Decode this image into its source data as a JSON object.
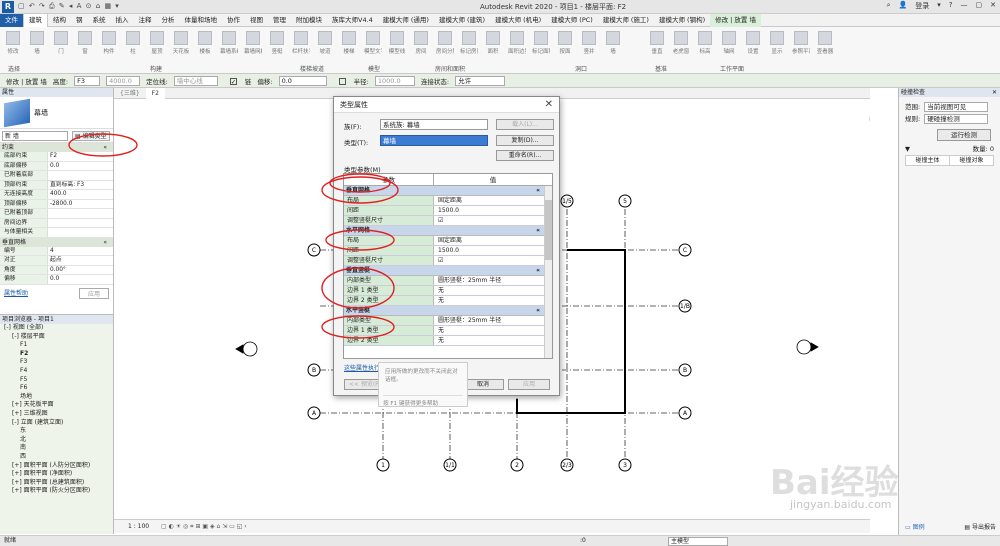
{
  "app": {
    "title": "Autodesk Revit 2020 - 项目1 - 楼层平面: F2",
    "user": "登录",
    "logo": "R"
  },
  "tabs": [
    "文件",
    "建筑",
    "结构",
    "钢",
    "系统",
    "插入",
    "注释",
    "分析",
    "体量和场地",
    "协作",
    "视图",
    "管理",
    "附加模块",
    "族库大师V4.4",
    "建模大师 (通用)",
    "建模大师 (建筑)",
    "建模大师 (机电)",
    "建模大师 (PC)",
    "建模大师 (施工)",
    "建模大师 (钢构)",
    "修改 | 放置 墙"
  ],
  "ribbon": {
    "buttons": [
      "修改",
      "墙",
      "门",
      "窗",
      "构件",
      "柱",
      "屋顶",
      "天花板",
      "楼板",
      "幕墙系统",
      "幕墙网格",
      "竖梃",
      "栏杆扶手",
      "坡道",
      "楼梯",
      "模型文字",
      "模型线",
      "房间",
      "房间分隔",
      "标记房间",
      "面积",
      "面积边界",
      "标记面积",
      "按面",
      "竖井",
      "墙",
      "垂直",
      "老虎窗",
      "标高",
      "轴网",
      "设置",
      "显示",
      "参照平面",
      "查看器"
    ],
    "panels": [
      "选择",
      "构建",
      "楼梯坡道",
      "模型",
      "房间和面积",
      "洞口",
      "基准",
      "工作平面"
    ]
  },
  "optbar": {
    "modify": "修改 | 放置 墙",
    "height_label": "高度:",
    "height_level": "F3",
    "height_value": "4000.0",
    "locline_label": "定位线:",
    "locline_value": "墙中心线",
    "chain_label": "链",
    "offset_label": "偏移:",
    "offset_value": "0.0",
    "radius_label": "半径:",
    "radius_value": "1000.0",
    "join_label": "连接状态:",
    "join_value": "允许"
  },
  "properties": {
    "header": "属性",
    "type_name": "幕墙",
    "new_label": "新 墙",
    "edit_type": "编辑类型",
    "constraints_head": "约束",
    "rows": [
      {
        "k": "底部约束",
        "v": "F2"
      },
      {
        "k": "底部偏移",
        "v": "0.0"
      },
      {
        "k": "已附着底部",
        "v": ""
      },
      {
        "k": "顶部约束",
        "v": "直到标高: F3"
      },
      {
        "k": "无连接高度",
        "v": "400.0"
      },
      {
        "k": "顶部偏移",
        "v": "-2800.0"
      },
      {
        "k": "已附着顶部",
        "v": ""
      },
      {
        "k": "房间边界",
        "v": ""
      },
      {
        "k": "与体量相关",
        "v": ""
      }
    ],
    "vgrid_head": "垂直网格",
    "vrows": [
      {
        "k": "编号",
        "v": "4"
      },
      {
        "k": "对正",
        "v": "起点"
      },
      {
        "k": "角度",
        "v": "0.00°"
      },
      {
        "k": "偏移",
        "v": "0.0"
      }
    ],
    "help": "属性帮助",
    "apply": "应用"
  },
  "browser": {
    "header": "项目浏览器 - 项目1",
    "items": [
      "[-] 视图 (全部)",
      "[-] 楼层平面",
      "F1",
      "F2",
      "F3",
      "F4",
      "F5",
      "F6",
      "场地",
      "[+] 天花板平面",
      "[+] 三维视图",
      "[-] 立面 (建筑立面)",
      "东",
      "北",
      "南",
      "西",
      "[+] 面积平面 (人防分区面积)",
      "[+] 面积平面 (净面积)",
      "[+] 面积平面 (总建筑面积)",
      "[+] 面积平面 (防火分区面积)"
    ]
  },
  "viewtabs": [
    "{三维}",
    "F2"
  ],
  "scale": "1 : 100",
  "status": {
    "left": "就绪",
    "main_model": "主模型",
    "zero": ":0"
  },
  "right": {
    "title": "碰撞检查",
    "range_label": "范围:",
    "range_value": "当前视图可见",
    "rule_label": "规则:",
    "rule_value": "硬碰撞检测",
    "run": "运行检测",
    "count_label": "数量:",
    "count": "0",
    "col1": "碰撞主体",
    "col2": "碰撞对象",
    "export": "导出报告",
    "tip_text": "图例"
  },
  "dialog": {
    "title": "类型属性",
    "family_label": "族(F):",
    "family_value": "系统族: 幕墙",
    "load": "载入(L)...",
    "type_label": "类型(T):",
    "type_value": "幕墙",
    "dup": "复制(D)...",
    "rename": "重命名(R)...",
    "params_label": "类型参数(M)",
    "col_param": "参数",
    "col_value": "值",
    "sections": [
      {
        "name": "垂直网格",
        "rows": [
          {
            "k": "布局",
            "v": "固定距离"
          },
          {
            "k": "间距",
            "v": "1500.0"
          },
          {
            "k": "调整竖梃尺寸",
            "v": "☑"
          }
        ]
      },
      {
        "name": "水平网格",
        "rows": [
          {
            "k": "布局",
            "v": "固定距离"
          },
          {
            "k": "间距",
            "v": "1500.0"
          },
          {
            "k": "调整竖梃尺寸",
            "v": "☑"
          }
        ]
      },
      {
        "name": "垂直竖梃",
        "rows": [
          {
            "k": "内部类型",
            "v": "圆形竖梃：25mm 半径"
          },
          {
            "k": "边界 1 类型",
            "v": "无"
          },
          {
            "k": "边界 2 类型",
            "v": "无"
          }
        ]
      },
      {
        "name": "水平竖梃",
        "rows": [
          {
            "k": "内部类型",
            "v": "圆形竖梃：25mm 半径"
          },
          {
            "k": "边界 1 类型",
            "v": "无"
          },
          {
            "k": "边界 2 类型",
            "v": "无"
          }
        ]
      }
    ],
    "link": "这些属性执行什么操作?",
    "preview": "<< 预览(P)",
    "ok": "确定",
    "cancel": "取消",
    "apply": "应用",
    "tip1": "应用所做的更改而不关闭此对话框。",
    "tip2": "按 F1 键获得更多帮助"
  },
  "grid_labels": {
    "top": [
      "1/5",
      "5"
    ],
    "bottom": [
      "1",
      "1/1",
      "2",
      "2/3",
      "3"
    ],
    "left": [
      "C",
      "B",
      "A"
    ],
    "right": [
      "C",
      "1/B",
      "B",
      "A"
    ]
  },
  "watermark": {
    "brand": "Bai经验",
    "url": "jingyan.baidu.com"
  }
}
